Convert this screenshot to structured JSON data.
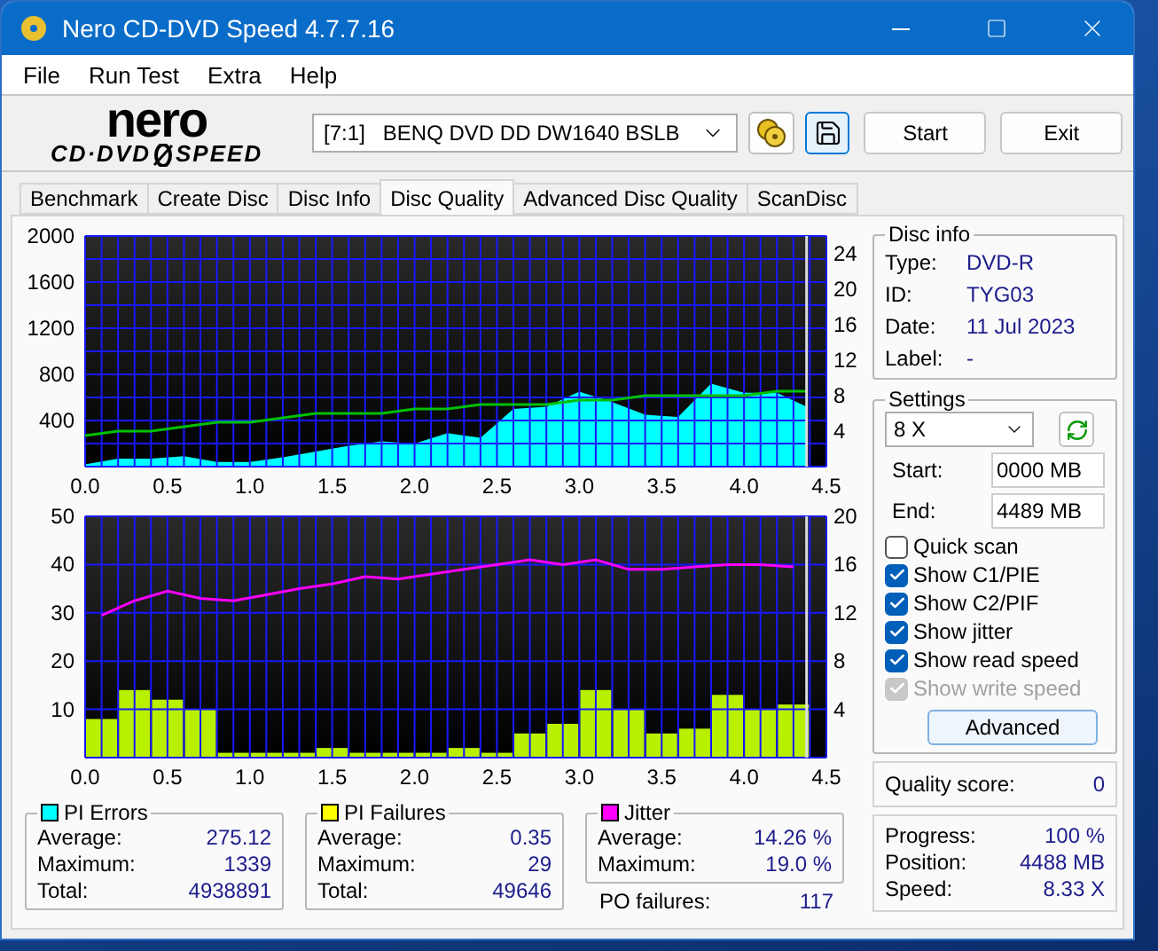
{
  "window": {
    "title": "Nero CD-DVD Speed 4.7.7.16"
  },
  "menu": [
    "File",
    "Run Test",
    "Extra",
    "Help"
  ],
  "logo": {
    "brand": "nero",
    "product_left": "CD·DVD",
    "product_right": "SPEED"
  },
  "drive": {
    "id": "[7:1]",
    "name": "BENQ DVD DD DW1640 BSLB"
  },
  "buttons": [
    "Start",
    "Exit"
  ],
  "tabs": [
    {
      "label": "Benchmark",
      "selected": false
    },
    {
      "label": "Create Disc",
      "selected": false
    },
    {
      "label": "Disc Info",
      "selected": false
    },
    {
      "label": "Disc Quality",
      "selected": true
    },
    {
      "label": "Advanced Disc Quality",
      "selected": false
    },
    {
      "label": "ScanDisc",
      "selected": false
    }
  ],
  "charts": [
    {
      "chart_data": {
        "type": "area",
        "x": [
          0,
          0.2,
          0.4,
          0.6,
          0.8,
          1.0,
          1.2,
          1.4,
          1.6,
          1.8,
          2.0,
          2.2,
          2.4,
          2.6,
          2.8,
          3.0,
          3.2,
          3.4,
          3.6,
          3.8,
          4.0,
          4.2,
          4.38
        ],
        "series": [
          {
            "color": "#00ffff",
            "values": [
              20,
              70,
              70,
              90,
              40,
              40,
              80,
              130,
              180,
              220,
              200,
              290,
              250,
              500,
              520,
              650,
              560,
              450,
              430,
              720,
              640,
              640,
              520
            ]
          },
          {
            "type": "line",
            "color": "#00c000",
            "axis": "y2",
            "values": [
              3.5,
              4,
              4,
              4.5,
              5,
              5,
              5.5,
              6,
              6,
              6,
              6.5,
              6.5,
              7,
              7,
              7,
              7.5,
              7.5,
              8,
              8,
              8,
              8,
              8.5,
              8.5
            ]
          }
        ],
        "xlim": [
          0,
          4.5
        ],
        "ylim": [
          0,
          2000
        ],
        "y2lim": [
          0,
          26
        ],
        "grid": true,
        "ref_lines": [
          {
            "axis": "x",
            "value": 4.38,
            "color": "#dddddd"
          }
        ],
        "xticks": [
          {
            "value": 0,
            "label": "0.0"
          },
          {
            "value": 0.5,
            "label": "0.5"
          },
          {
            "value": 1,
            "label": "1.0"
          },
          {
            "value": 1.5,
            "label": "1.5"
          },
          {
            "value": 2,
            "label": "2.0"
          },
          {
            "value": 2.5,
            "label": "2.5"
          },
          {
            "value": 3,
            "label": "3.0"
          },
          {
            "value": 3.5,
            "label": "3.5"
          },
          {
            "value": 4,
            "label": "4.0"
          },
          {
            "value": 4.5,
            "label": "4.5"
          }
        ],
        "yticks": [
          400,
          800,
          1200,
          1600,
          2000
        ],
        "y2ticks": [
          4,
          8,
          12,
          16,
          20,
          24
        ]
      }
    },
    {
      "chart_data": {
        "type": "bar",
        "x": [
          0.1,
          0.3,
          0.5,
          0.7,
          0.9,
          1.1,
          1.3,
          1.5,
          1.7,
          1.9,
          2.1,
          2.3,
          2.5,
          2.7,
          2.9,
          3.1,
          3.3,
          3.5,
          3.7,
          3.9,
          4.1,
          4.3
        ],
        "series": [
          {
            "color": "#b8f000",
            "values": [
              8,
              14,
              12,
              10,
              1,
              1,
              1,
              2,
              1,
              1,
              1,
              2,
              1,
              5,
              7,
              14,
              10,
              5,
              6,
              13,
              10,
              11
            ]
          },
          {
            "type": "line",
            "color": "#ff00ff",
            "axis": "y2",
            "values": [
              11.8,
              13.0,
              13.8,
              13.2,
              13.0,
              13.5,
              14.0,
              14.4,
              15.0,
              14.8,
              15.2,
              15.6,
              16.0,
              16.4,
              16.0,
              16.4,
              15.6,
              15.6,
              15.8,
              16.0,
              16.0,
              15.8
            ]
          }
        ],
        "xlim": [
          0,
          4.5
        ],
        "ylim": [
          0,
          50
        ],
        "y2lim": [
          0,
          20
        ],
        "grid": true,
        "ref_lines": [
          {
            "axis": "x",
            "value": 4.38,
            "color": "#dddddd"
          }
        ],
        "xticks": [
          {
            "value": 0,
            "label": "0.0"
          },
          {
            "value": 0.5,
            "label": "0.5"
          },
          {
            "value": 1,
            "label": "1.0"
          },
          {
            "value": 1.5,
            "label": "1.5"
          },
          {
            "value": 2,
            "label": "2.0"
          },
          {
            "value": 2.5,
            "label": "2.5"
          },
          {
            "value": 3,
            "label": "3.0"
          },
          {
            "value": 3.5,
            "label": "3.5"
          },
          {
            "value": 4,
            "label": "4.0"
          },
          {
            "value": 4.5,
            "label": "4.5"
          }
        ],
        "yticks": [
          10,
          20,
          30,
          40,
          50
        ],
        "y2ticks": [
          4,
          8,
          12,
          16,
          20
        ]
      }
    }
  ],
  "stats": [
    {
      "title": "PI Errors",
      "color": "#00ffff",
      "rows": [
        {
          "label": "Average:",
          "value": "275.12"
        },
        {
          "label": "Maximum:",
          "value": "1339"
        },
        {
          "label": "Total:",
          "value": "4938891"
        }
      ]
    },
    {
      "title": "PI Failures",
      "color": "#ffff00",
      "rows": [
        {
          "label": "Average:",
          "value": "0.35"
        },
        {
          "label": "Maximum:",
          "value": "29"
        },
        {
          "label": "Total:",
          "value": "49646"
        }
      ]
    },
    {
      "title": "Jitter",
      "color": "#ff00ff",
      "rows": [
        {
          "label": "Average:",
          "value": "14.26 %"
        },
        {
          "label": "Maximum:",
          "value": "19.0 %"
        }
      ]
    }
  ],
  "po_failures": {
    "label": "PO failures:",
    "value": "117"
  },
  "disc_info": {
    "title": "Disc info",
    "rows": [
      {
        "label": "Type:",
        "value": "DVD-R"
      },
      {
        "label": "ID:",
        "value": "TYG03"
      },
      {
        "label": "Date:",
        "value": "11 Jul 2023"
      },
      {
        "label": "Label:",
        "value": "-"
      }
    ]
  },
  "settings": {
    "title": "Settings",
    "speed": "8 X",
    "start": {
      "label": "Start:",
      "value": "0000 MB"
    },
    "end": {
      "label": "End:",
      "value": "4489 MB"
    },
    "options": [
      {
        "label": "Quick scan",
        "checked": false,
        "disabled": false
      },
      {
        "label": "Show C1/PIE",
        "checked": true,
        "disabled": false
      },
      {
        "label": "Show C2/PIF",
        "checked": true,
        "disabled": false
      },
      {
        "label": "Show jitter",
        "checked": true,
        "disabled": false
      },
      {
        "label": "Show read speed",
        "checked": true,
        "disabled": false
      },
      {
        "label": "Show write speed",
        "checked": true,
        "disabled": true
      }
    ],
    "advanced": "Advanced"
  },
  "quality": {
    "label": "Quality score:",
    "value": "0"
  },
  "progress": [
    {
      "label": "Progress:",
      "value": "100 %"
    },
    {
      "label": "Position:",
      "value": "4488 MB"
    },
    {
      "label": "Speed:",
      "value": "8.33 X"
    }
  ]
}
